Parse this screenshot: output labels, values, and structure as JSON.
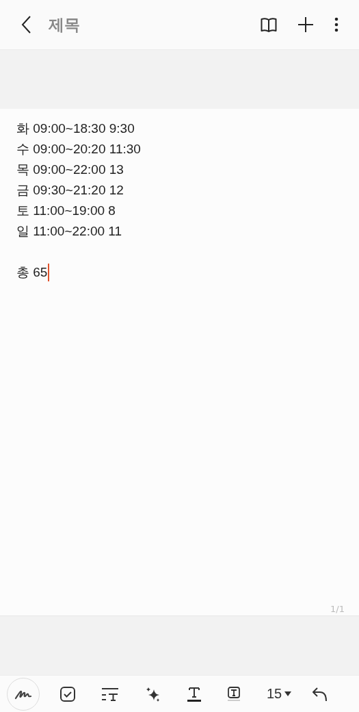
{
  "header": {
    "title": "제목"
  },
  "note": {
    "paragraphs": [
      {
        "lines": [
          "화 09:00~18:30 9:30",
          "수 09:00~20:20 11:30",
          "목 09:00~22:00 13",
          "금 09:30~21:20 12",
          "토 11:00~19:00 8",
          "일 11:00~22:00 11"
        ]
      },
      {
        "lines": [
          "총 65"
        ]
      }
    ],
    "cursor": true
  },
  "page_indicator": "1/1",
  "toolbar": {
    "font_size": "15"
  }
}
